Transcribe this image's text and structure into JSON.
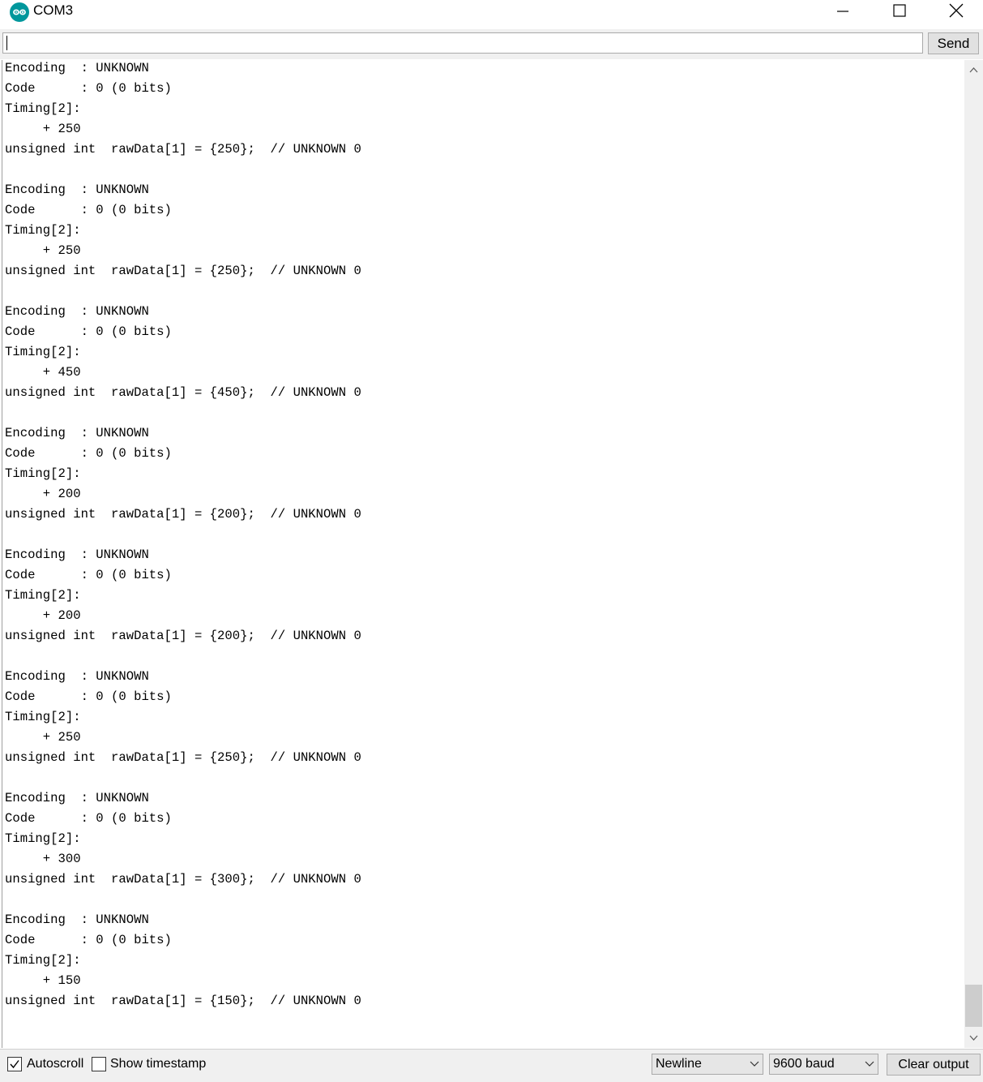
{
  "window": {
    "title": "COM3"
  },
  "send_bar": {
    "input_value": "",
    "send_label": "Send"
  },
  "output_lines": [
    "Encoding  : UNKNOWN",
    "Code      : 0 (0 bits)",
    "Timing[2]:",
    "     + 250",
    "unsigned int  rawData[1] = {250};  // UNKNOWN 0",
    "",
    "Encoding  : UNKNOWN",
    "Code      : 0 (0 bits)",
    "Timing[2]:",
    "     + 250",
    "unsigned int  rawData[1] = {250};  // UNKNOWN 0",
    "",
    "Encoding  : UNKNOWN",
    "Code      : 0 (0 bits)",
    "Timing[2]:",
    "     + 450",
    "unsigned int  rawData[1] = {450};  // UNKNOWN 0",
    "",
    "Encoding  : UNKNOWN",
    "Code      : 0 (0 bits)",
    "Timing[2]:",
    "     + 200",
    "unsigned int  rawData[1] = {200};  // UNKNOWN 0",
    "",
    "Encoding  : UNKNOWN",
    "Code      : 0 (0 bits)",
    "Timing[2]:",
    "     + 200",
    "unsigned int  rawData[1] = {200};  // UNKNOWN 0",
    "",
    "Encoding  : UNKNOWN",
    "Code      : 0 (0 bits)",
    "Timing[2]:",
    "     + 250",
    "unsigned int  rawData[1] = {250};  // UNKNOWN 0",
    "",
    "Encoding  : UNKNOWN",
    "Code      : 0 (0 bits)",
    "Timing[2]:",
    "     + 300",
    "unsigned int  rawData[1] = {300};  // UNKNOWN 0",
    "",
    "Encoding  : UNKNOWN",
    "Code      : 0 (0 bits)",
    "Timing[2]:",
    "     + 150",
    "unsigned int  rawData[1] = {150};  // UNKNOWN 0"
  ],
  "bottom_bar": {
    "autoscroll_label": "Autoscroll",
    "autoscroll_checked": true,
    "timestamp_label": "Show timestamp",
    "timestamp_checked": false,
    "line_ending": "Newline",
    "baud_rate": "9600 baud",
    "clear_label": "Clear output"
  },
  "colors": {
    "logo": "#00979c",
    "panel": "#f0f0f0",
    "button": "#e1e1e1"
  },
  "icons": {
    "logo": "arduino-logo-icon",
    "minimize": "minimize-icon",
    "maximize": "maximize-icon",
    "close": "close-icon",
    "scroll_up": "chevron-up-icon",
    "scroll_down": "chevron-down-icon",
    "dropdown": "chevron-down-icon",
    "check": "checkmark-icon"
  }
}
